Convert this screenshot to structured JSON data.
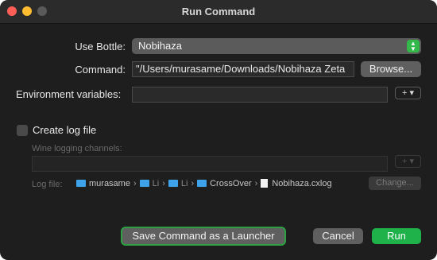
{
  "window": {
    "title": "Run Command"
  },
  "form": {
    "bottle_label": "Use Bottle:",
    "bottle_value": "Nobihaza",
    "command_label": "Command:",
    "command_value": "\"/Users/murasame/Downloads/Nobihaza Zeta",
    "browse_label": "Browse...",
    "env_label": "Environment variables:",
    "env_value": "",
    "add_label": "+ ▾"
  },
  "log": {
    "create_label": "Create log file",
    "checked": false,
    "wine_channels_label": "Wine logging channels:",
    "wine_channels_value": "",
    "add_label": "+ ▾",
    "logfile_label": "Log file:",
    "path": {
      "seg1": "murasame",
      "seg2": "Li",
      "seg3": "Li",
      "seg4": "CrossOver",
      "file": "Nobihaza.cxlog",
      "separator": "›"
    },
    "change_label": "Change..."
  },
  "footer": {
    "launcher_label": "Save Command as a Launcher",
    "cancel_label": "Cancel",
    "run_label": "Run"
  },
  "colors": {
    "accent_green": "#1fb14a",
    "folder_blue": "#3ea3ea",
    "close": "#ff5f57",
    "minimize": "#febc2e"
  }
}
